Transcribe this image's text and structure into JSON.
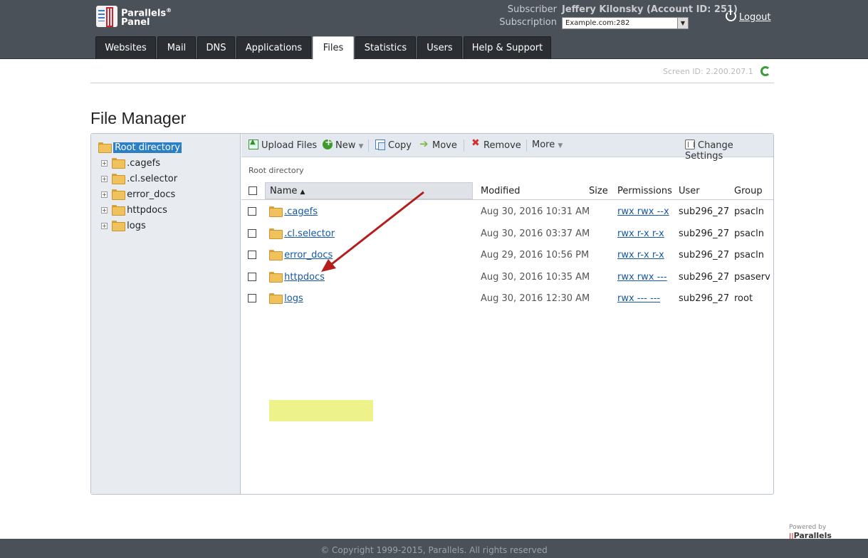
{
  "brand": {
    "line1": "Parallels",
    "reg": "®",
    "line2": "Panel"
  },
  "header": {
    "subscriber_label": "Subscriber",
    "subscriber_value": "Jeffery Kilonsky (Account ID: 251)",
    "subscription_label": "Subscription",
    "subscription_value": "Example.com:282",
    "logout": "Logout"
  },
  "tabs": [
    {
      "label": "Websites"
    },
    {
      "label": "Mail"
    },
    {
      "label": "DNS"
    },
    {
      "label": "Applications"
    },
    {
      "label": "Files"
    },
    {
      "label": "Statistics"
    },
    {
      "label": "Users"
    },
    {
      "label": "Help & Support"
    }
  ],
  "active_tab": "Files",
  "screen_id": "Screen ID:  2.200.207.1",
  "page_title": "File Manager",
  "tree": {
    "root": "Root directory",
    "items": [
      ".cagefs",
      ".cl.selector",
      "error_docs",
      "httpdocs",
      "logs"
    ]
  },
  "toolbar": {
    "upload": "Upload Files",
    "new": "New",
    "copy": "Copy",
    "move": "Move",
    "remove": "Remove",
    "more": "More",
    "settings": "Change Settings"
  },
  "breadcrumb": "Root directory",
  "columns": {
    "name": "Name",
    "modified": "Modified",
    "size": "Size",
    "permissions": "Permissions",
    "user": "User",
    "group": "Group"
  },
  "files": [
    {
      "name": ".cagefs",
      "modified": "Aug 30, 2016 10:31 AM",
      "size": "",
      "permissions": "rwx rwx --x",
      "user": "sub296_27",
      "group": "psacln"
    },
    {
      "name": ".cl.selector",
      "modified": "Aug 30, 2016 03:37 AM",
      "size": "",
      "permissions": "rwx r-x r-x",
      "user": "sub296_27",
      "group": "psacln"
    },
    {
      "name": "error_docs",
      "modified": "Aug 29, 2016 10:56 PM",
      "size": "",
      "permissions": "rwx r-x r-x",
      "user": "sub296_27",
      "group": "psacln"
    },
    {
      "name": "httpdocs",
      "modified": "Aug 30, 2016 10:35 AM",
      "size": "",
      "permissions": "rwx rwx ---",
      "user": "sub296_27",
      "group": "psaserv"
    },
    {
      "name": "logs",
      "modified": "Aug 30, 2016 12:30 AM",
      "size": "",
      "permissions": "rwx --- ---",
      "user": "sub296_27",
      "group": "root"
    }
  ],
  "highlighted_file": "httpdocs",
  "colors": {
    "header_bg": "#4b5158",
    "tab_bg": "#2b2f34",
    "selection": "#2b7fc4",
    "highlight": "#eef28a",
    "arrow": "#b51c1c",
    "link": "#1558a6"
  },
  "powered_by": {
    "label": "Powered by",
    "brand": "Parallels"
  },
  "footer": "© Copyright 1999-2015, Parallels. All rights reserved"
}
